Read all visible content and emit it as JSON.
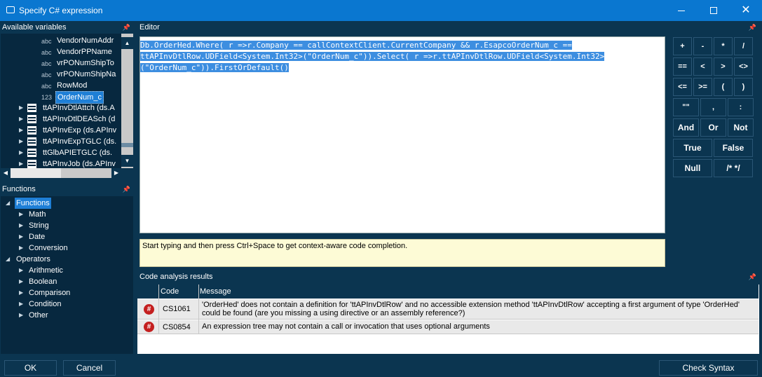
{
  "window": {
    "title": "Specify C# expression"
  },
  "variables_panel": {
    "header": "Available variables",
    "fields": [
      {
        "type": "abc",
        "name": "VendorNumAddr"
      },
      {
        "type": "abc",
        "name": "VendorPPName"
      },
      {
        "type": "abc",
        "name": "vrPONumShipTo"
      },
      {
        "type": "abc",
        "name": "vrPONumShipNa"
      },
      {
        "type": "abc",
        "name": "RowMod"
      },
      {
        "type": "123",
        "name": "OrderNum_c"
      }
    ],
    "tables": [
      "ttAPInvDtlAttch (ds.A",
      "ttAPInvDtlDEASch (d",
      "ttAPInvExp (ds.APInv",
      "ttAPInvExpTGLC (ds.",
      "ttGlbAPIETGLC (ds.",
      "ttAPInvJob (ds.APInv"
    ]
  },
  "functions_panel": {
    "header": "Functions",
    "groups": [
      {
        "label": "Functions",
        "children": [
          "Math",
          "String",
          "Date",
          "Conversion"
        ]
      },
      {
        "label": "Operators",
        "children": [
          "Arithmetic",
          "Boolean",
          "Comparison",
          "Condition",
          "Other"
        ]
      }
    ]
  },
  "editor": {
    "header": "Editor",
    "code_lines": [
      "Db.OrderHed.Where( r =>r.Company == callContextClient.CurrentCompany && r.EsapcoOrderNum_c ==",
      "ttAPInvDtlRow.UDField<System.Int32>(\"OrderNum_c\")).Select( r =>r.ttAPInvDtlRow.UDField<System.Int32>",
      "(\"OrderNum_c\")).FirstOrDefault()"
    ],
    "hint": "Start typing and then press Ctrl+Space to get context-aware code completion."
  },
  "keypad": {
    "small_keys": [
      "+",
      "-",
      "*",
      "/",
      "==",
      "<",
      ">",
      "<>",
      "<=",
      ">=",
      "(",
      ")",
      "\"\"",
      ",",
      ":"
    ],
    "wide_keys": [
      "And",
      "Or",
      "Not",
      "True",
      "False",
      "Null",
      "/* */"
    ]
  },
  "analysis": {
    "header": "Code analysis results",
    "columns": [
      "Code",
      "Message"
    ],
    "rows": [
      {
        "code": "CS1061",
        "message": "'OrderHed' does not contain a definition for 'ttAPInvDtlRow' and no accessible extension method 'ttAPInvDtlRow' accepting a first argument of type 'OrderHed' could be found (are you missing a using directive or an assembly reference?)"
      },
      {
        "code": "CS0854",
        "message": "An expression tree may not contain a call or invocation that uses optional arguments"
      }
    ]
  },
  "buttons": {
    "ok": "OK",
    "cancel": "Cancel",
    "check": "Check Syntax"
  },
  "colors": {
    "titlebar": "#0a77d0",
    "panel": "#0b3550",
    "selection": "#1e7fd6",
    "error": "#c41f1f"
  }
}
